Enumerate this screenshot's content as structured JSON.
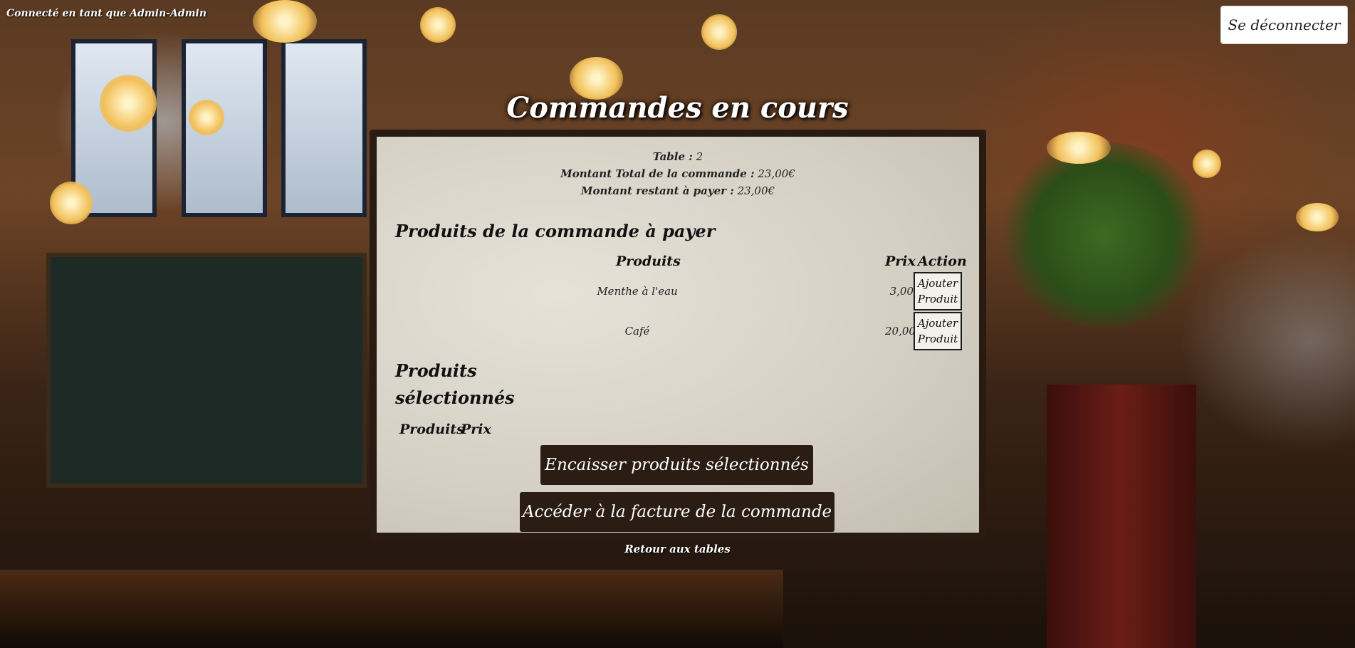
{
  "header": {
    "user_label": "Connecté en tant que Admin-Admin",
    "logout_label": "Se déconnecter"
  },
  "page": {
    "title": "Commandes en cours"
  },
  "order": {
    "table_label": "Table :",
    "table_value": "2",
    "total_label": "Montant Total de la commande :",
    "total_value": "23,00€",
    "remaining_label": "Montant restant à payer :",
    "remaining_value": "23,00€"
  },
  "products_section": {
    "title": "Produits de la commande à payer",
    "columns": [
      "Produits",
      "Prix",
      "Action"
    ],
    "rows": [
      {
        "product": "Menthe à l'eau",
        "price": "3,00",
        "action": "Ajouter Produit"
      },
      {
        "product": "Café",
        "price": "20,00",
        "action": "Ajouter Produit"
      }
    ]
  },
  "selected_section": {
    "title": "Produits sélectionnés",
    "columns": [
      "Produits",
      "Prix"
    ]
  },
  "actions": {
    "encaisser_label": "Encaisser produits sélectionnés",
    "facture_label": "Accéder à la facture de la commande",
    "back_label": "Retour aux tables"
  }
}
